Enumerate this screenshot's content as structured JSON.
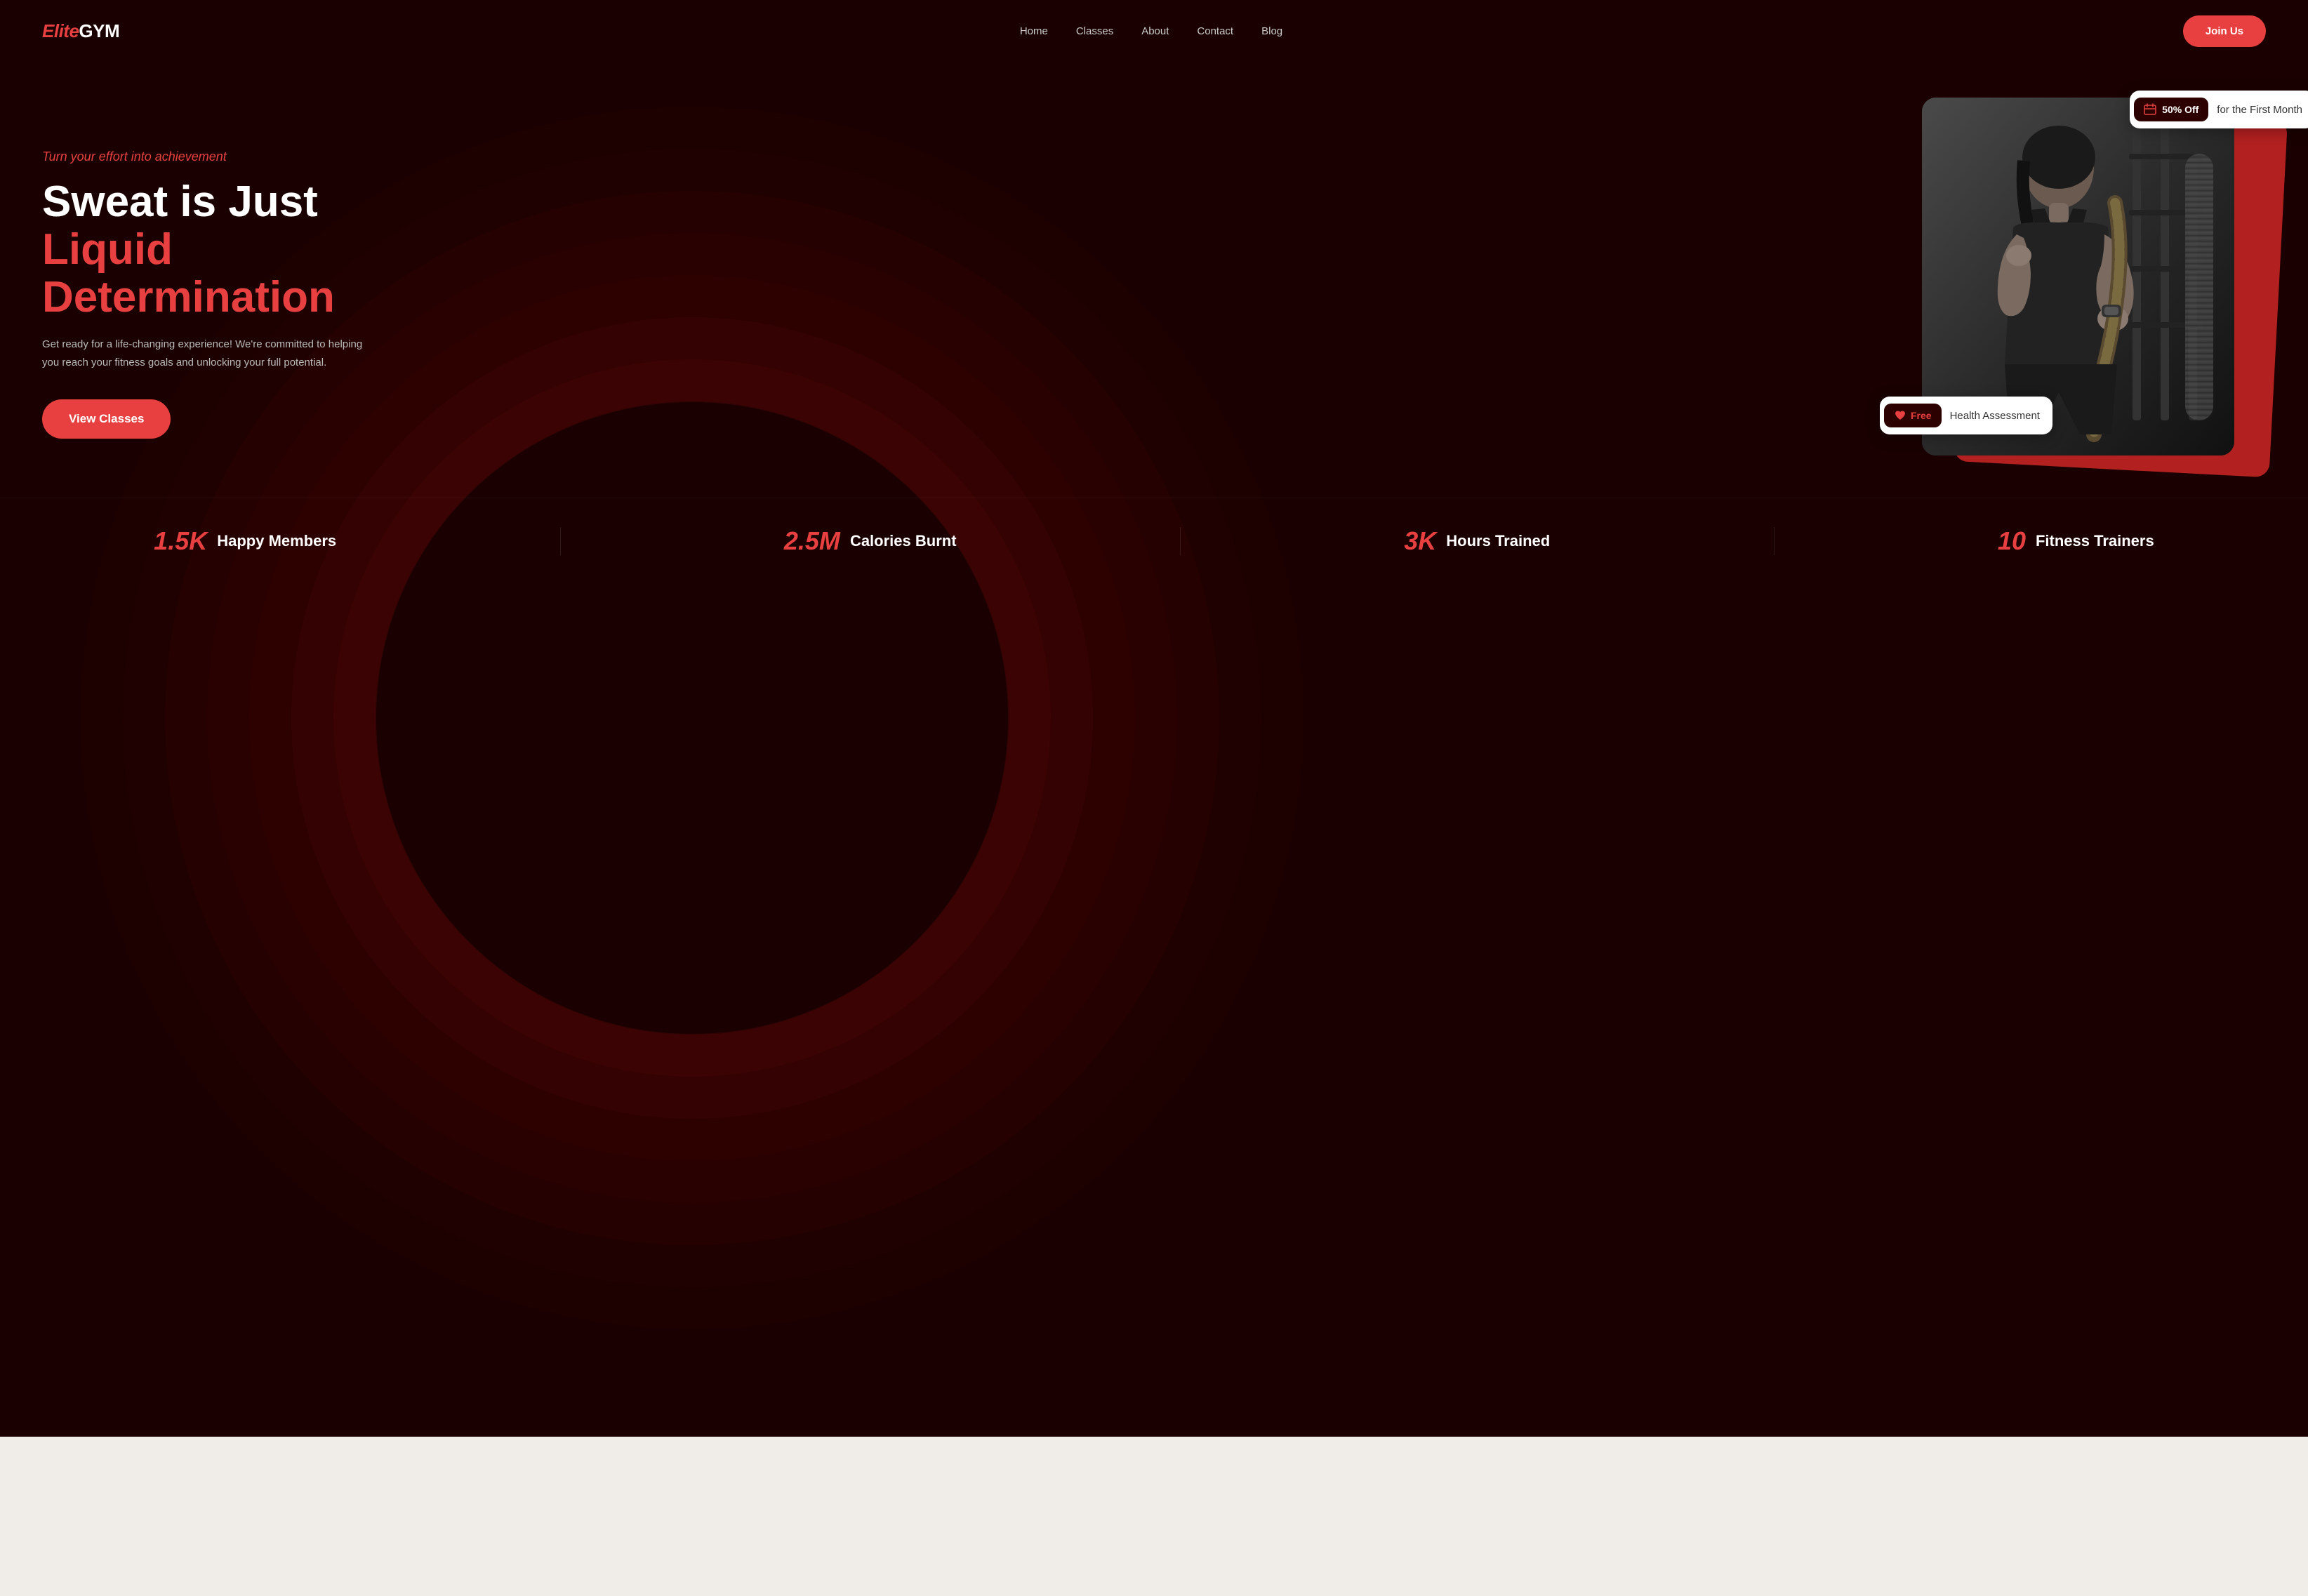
{
  "brand": {
    "elite": "Elite",
    "gym": "GYM"
  },
  "nav": {
    "links": [
      {
        "label": "Home",
        "id": "home"
      },
      {
        "label": "Classes",
        "id": "classes"
      },
      {
        "label": "About",
        "id": "about"
      },
      {
        "label": "Contact",
        "id": "contact"
      },
      {
        "label": "Blog",
        "id": "blog"
      }
    ],
    "join_label": "Join Us"
  },
  "hero": {
    "subtitle": "Turn your effort into achievement",
    "title_line1": "Sweat is Just",
    "title_line2": "Liquid Determination",
    "description": "Get ready for a life-changing experience! We're committed to helping you reach your fitness goals and unlocking your full potential.",
    "cta_label": "View Classes"
  },
  "badge_discount": {
    "tag": "50% Off",
    "text": "for the First Month"
  },
  "badge_health": {
    "tag": "Free",
    "text": "Health Assessment"
  },
  "stats": [
    {
      "number": "1.5K",
      "label": "Happy Members"
    },
    {
      "number": "2.5M",
      "label": "Calories Burnt"
    },
    {
      "number": "3K",
      "label": "Hours Trained"
    },
    {
      "number": "10",
      "label": "Fitness Trainers"
    }
  ],
  "colors": {
    "accent": "#e84040",
    "bg_dark": "#1a0000",
    "bg_body": "#f0ede8"
  }
}
